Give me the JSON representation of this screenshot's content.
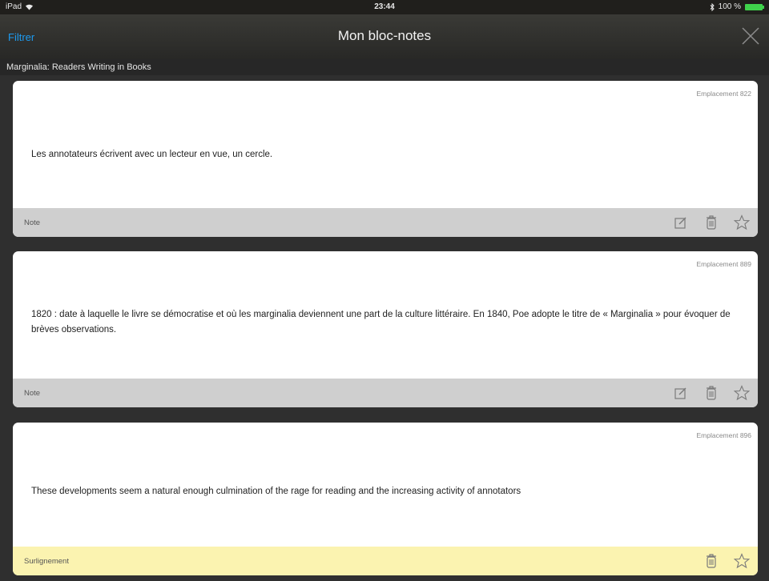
{
  "status": {
    "device": "iPad",
    "time": "23:44",
    "battery": "100 %"
  },
  "nav": {
    "filter_label": "Filtrer",
    "title": "Mon bloc-notes"
  },
  "book_title": "Marginalia: Readers Writing in Books",
  "cards": [
    {
      "location": "Emplacement 822",
      "text": "Les annotateurs écrivent avec un lecteur en vue, un cercle.",
      "type": "Note"
    },
    {
      "location": "Emplacement 889",
      "text": "1820 : date à laquelle le livre se démocratise et où les marginalia deviennent une part de la culture littéraire. En 1840, Poe adopte le titre de « Marginalia » pour évoquer de brèves observations.",
      "type": "Note"
    },
    {
      "location": "Emplacement 896",
      "text": "These developments seem a natural enough culmination of the rage for reading and the increasing activity of annotators",
      "type": "Surlignement"
    }
  ],
  "colors": {
    "accent": "#1d9bf0",
    "note_footer": "#cfcfcf",
    "highlight_footer": "#fbf3b0"
  }
}
